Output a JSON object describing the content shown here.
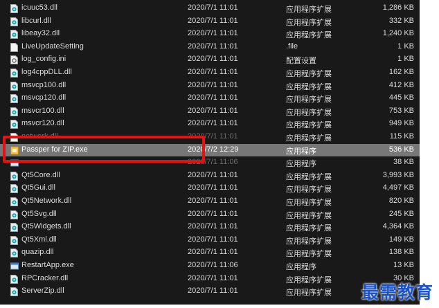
{
  "files": [
    {
      "name": "icuuc53.dll",
      "date": "2020/7/1 11:01",
      "type": "应用程序扩展",
      "size": "1,286 KB",
      "icon": "dll-icon"
    },
    {
      "name": "libcurl.dll",
      "date": "2020/7/1 11:01",
      "type": "应用程序扩展",
      "size": "332 KB",
      "icon": "dll-icon"
    },
    {
      "name": "libeay32.dll",
      "date": "2020/7/1 11:01",
      "type": "应用程序扩展",
      "size": "1,240 KB",
      "icon": "dll-icon"
    },
    {
      "name": "LiveUpdateSetting",
      "date": "2020/7/1 11:01",
      "type": ".file",
      "size": "1 KB",
      "icon": "blank-file-icon"
    },
    {
      "name": "log_config.ini",
      "date": "2020/7/1 11:01",
      "type": "配置设置",
      "size": "1 KB",
      "icon": "config-file-icon"
    },
    {
      "name": "log4cppDLL.dll",
      "date": "2020/7/1 11:01",
      "type": "应用程序扩展",
      "size": "162 KB",
      "icon": "dll-icon"
    },
    {
      "name": "msvcp100.dll",
      "date": "2020/7/1 11:01",
      "type": "应用程序扩展",
      "size": "412 KB",
      "icon": "dll-icon"
    },
    {
      "name": "msvcp120.dll",
      "date": "2020/7/1 11:01",
      "type": "应用程序扩展",
      "size": "445 KB",
      "icon": "dll-icon"
    },
    {
      "name": "msvcr100.dll",
      "date": "2020/7/1 11:01",
      "type": "应用程序扩展",
      "size": "753 KB",
      "icon": "dll-icon"
    },
    {
      "name": "msvcr120.dll",
      "date": "2020/7/1 11:01",
      "type": "应用程序扩展",
      "size": "949 KB",
      "icon": "dll-icon"
    },
    {
      "name": "network.dll",
      "date": "2020/7/1 11:01",
      "type": "应用程序扩展",
      "size": "115 KB",
      "icon": "blank-file-icon",
      "obscured": true
    },
    {
      "name": "Passper for ZIP.exe",
      "date": "2020/7/2 12:29",
      "type": "应用程序",
      "size": "536 KB",
      "icon": "app-exe-icon",
      "selected": true
    },
    {
      "name": "",
      "date": "2020/7/1 11:06",
      "type": "应用程序",
      "size": "38 KB",
      "icon": "app-window-icon",
      "obscured": true
    },
    {
      "name": "Qt5Core.dll",
      "date": "2020/7/1 11:01",
      "type": "应用程序扩展",
      "size": "3,993 KB",
      "icon": "dll-icon"
    },
    {
      "name": "Qt5Gui.dll",
      "date": "2020/7/1 11:01",
      "type": "应用程序扩展",
      "size": "4,497 KB",
      "icon": "dll-icon"
    },
    {
      "name": "Qt5Network.dll",
      "date": "2020/7/1 11:01",
      "type": "应用程序扩展",
      "size": "820 KB",
      "icon": "dll-icon"
    },
    {
      "name": "Qt5Svg.dll",
      "date": "2020/7/1 11:01",
      "type": "应用程序扩展",
      "size": "245 KB",
      "icon": "dll-icon"
    },
    {
      "name": "Qt5Widgets.dll",
      "date": "2020/7/1 11:01",
      "type": "应用程序扩展",
      "size": "4,364 KB",
      "icon": "dll-icon"
    },
    {
      "name": "Qt5Xml.dll",
      "date": "2020/7/1 11:01",
      "type": "应用程序扩展",
      "size": "149 KB",
      "icon": "dll-icon"
    },
    {
      "name": "quazip.dll",
      "date": "2020/7/1 11:01",
      "type": "应用程序扩展",
      "size": "138 KB",
      "icon": "dll-icon"
    },
    {
      "name": "RestartApp.exe",
      "date": "2020/7/1 11:06",
      "type": "应用程序",
      "size": "13 KB",
      "icon": "app-window-icon"
    },
    {
      "name": "RPCracker.dll",
      "date": "2020/7/1 11:01",
      "type": "应用程序扩展",
      "size": "30 KB",
      "icon": "dll-icon"
    },
    {
      "name": "ServerZip.dll",
      "date": "2020/7/1 11:01",
      "type": "应用程序扩展",
      "size": "",
      "icon": "dll-icon"
    }
  ],
  "colors": {
    "background": "#191919",
    "selection": "#777777",
    "annotation": "#e31313",
    "watermark": "#1c53c6"
  },
  "watermark": "最需教育"
}
